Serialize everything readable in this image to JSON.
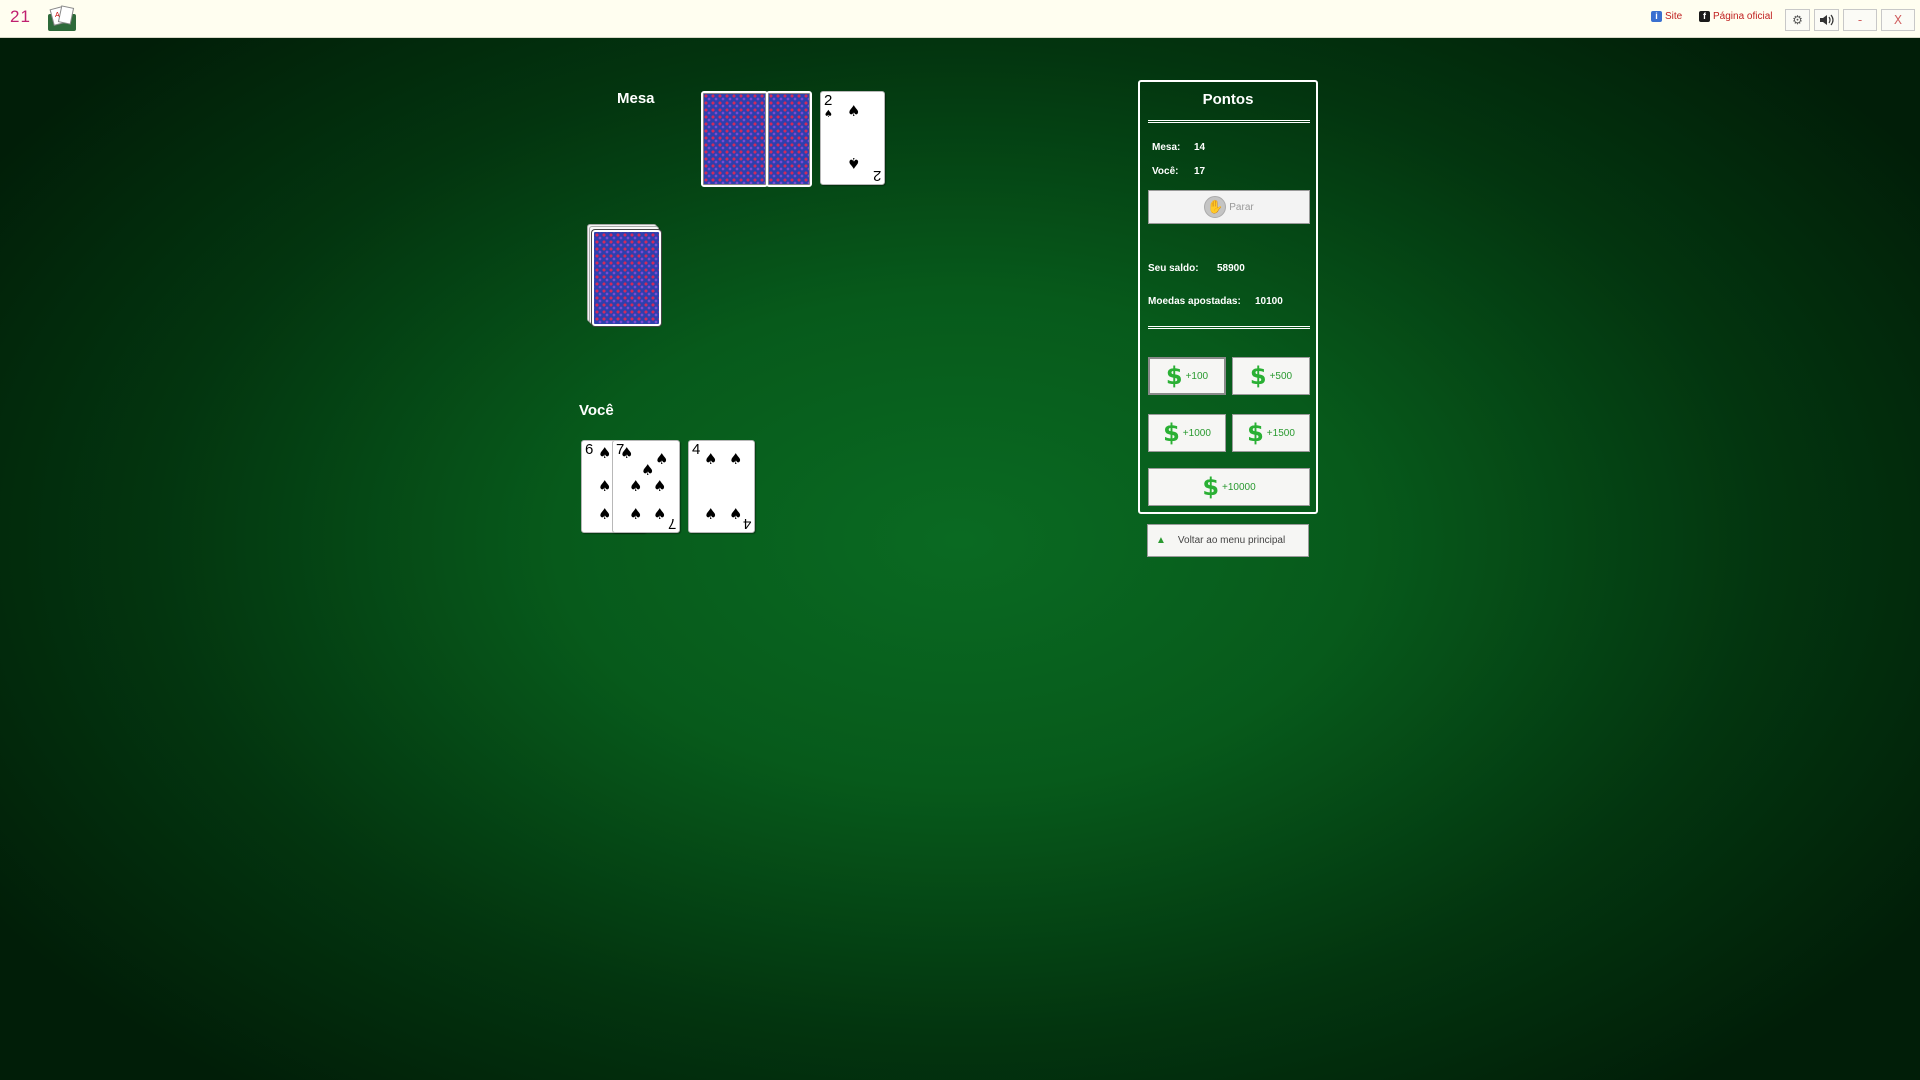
{
  "app": {
    "title": "21"
  },
  "topbar": {
    "site_label": "Site",
    "official_label": "Página oficial",
    "minimize_label": "-",
    "close_label": "X"
  },
  "table": {
    "dealer_label": "Mesa",
    "player_label": "Você"
  },
  "dealer_cards": [
    {
      "face": "down"
    },
    {
      "face": "down"
    },
    {
      "face": "up",
      "rank": "2",
      "suit": "spades"
    }
  ],
  "deck": {
    "face": "down"
  },
  "player_cards": [
    {
      "face": "up",
      "rank": "6",
      "suit": "spades"
    },
    {
      "face": "up",
      "rank": "7",
      "suit": "spades"
    },
    {
      "face": "up",
      "rank": "4",
      "suit": "spades"
    }
  ],
  "panel": {
    "title": "Pontos",
    "dealer_label": "Mesa:",
    "dealer_points": "14",
    "player_label": "Você:",
    "player_points": "17",
    "stop_label": "Parar",
    "balance_label": "Seu saldo:",
    "balance_value": "58900",
    "bet_label": "Moedas apostadas:",
    "bet_value": "10100",
    "bet_buttons": [
      "+100",
      "+500",
      "+1000",
      "+1500",
      "+10000"
    ],
    "back_label": "Voltar ao menu principal"
  },
  "colors": {
    "felt": "#075a1b",
    "money_green": "#2ab034",
    "title_pink": "#c02070"
  }
}
